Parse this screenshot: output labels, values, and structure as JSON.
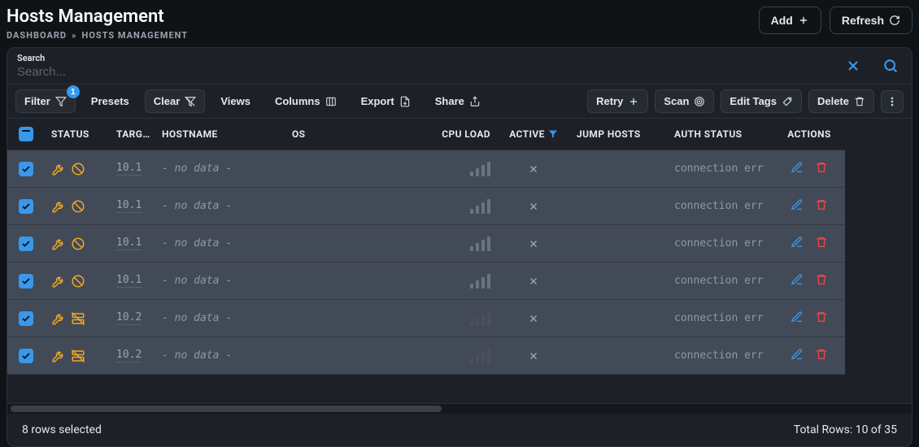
{
  "header": {
    "title": "Hosts Management",
    "breadcrumb": [
      "DASHBOARD",
      "HOSTS MANAGEMENT"
    ],
    "add_label": "Add",
    "refresh_label": "Refresh"
  },
  "search": {
    "label": "Search",
    "placeholder": "Search..."
  },
  "toolbar": {
    "left": {
      "filter": "Filter",
      "filter_badge": "1",
      "presets": "Presets",
      "clear": "Clear",
      "views": "Views",
      "columns": "Columns",
      "export": "Export",
      "share": "Share"
    },
    "right": {
      "retry": "Retry",
      "scan": "Scan",
      "edit_tags": "Edit Tags",
      "delete": "Delete"
    }
  },
  "table": {
    "columns": {
      "status": "STATUS",
      "target": "TARG…",
      "hostname": "HOSTNAME",
      "os": "OS",
      "cpu_load": "CPU LOAD",
      "active": "ACTIVE",
      "jump_hosts": "JUMP HOSTS",
      "auth_status": "AUTH STATUS",
      "actions": "ACTIONS"
    },
    "rows": [
      {
        "ip": "10.1",
        "hostname": "- no data -",
        "cpu_dim": false,
        "auth": "connection err",
        "status_variant": "block"
      },
      {
        "ip": "10.1",
        "hostname": "- no data -",
        "cpu_dim": false,
        "auth": "connection err",
        "status_variant": "block"
      },
      {
        "ip": "10.1",
        "hostname": "- no data -",
        "cpu_dim": false,
        "auth": "connection err",
        "status_variant": "block"
      },
      {
        "ip": "10.1",
        "hostname": "- no data -",
        "cpu_dim": false,
        "auth": "connection err",
        "status_variant": "block"
      },
      {
        "ip": "10.2",
        "hostname": "- no data -",
        "cpu_dim": true,
        "auth": "connection err",
        "status_variant": "server"
      },
      {
        "ip": "10.2",
        "hostname": "- no data -",
        "cpu_dim": true,
        "auth": "connection err",
        "status_variant": "server"
      }
    ]
  },
  "footer": {
    "selected": "8 rows selected",
    "total": "Total Rows: 10 of 35"
  }
}
